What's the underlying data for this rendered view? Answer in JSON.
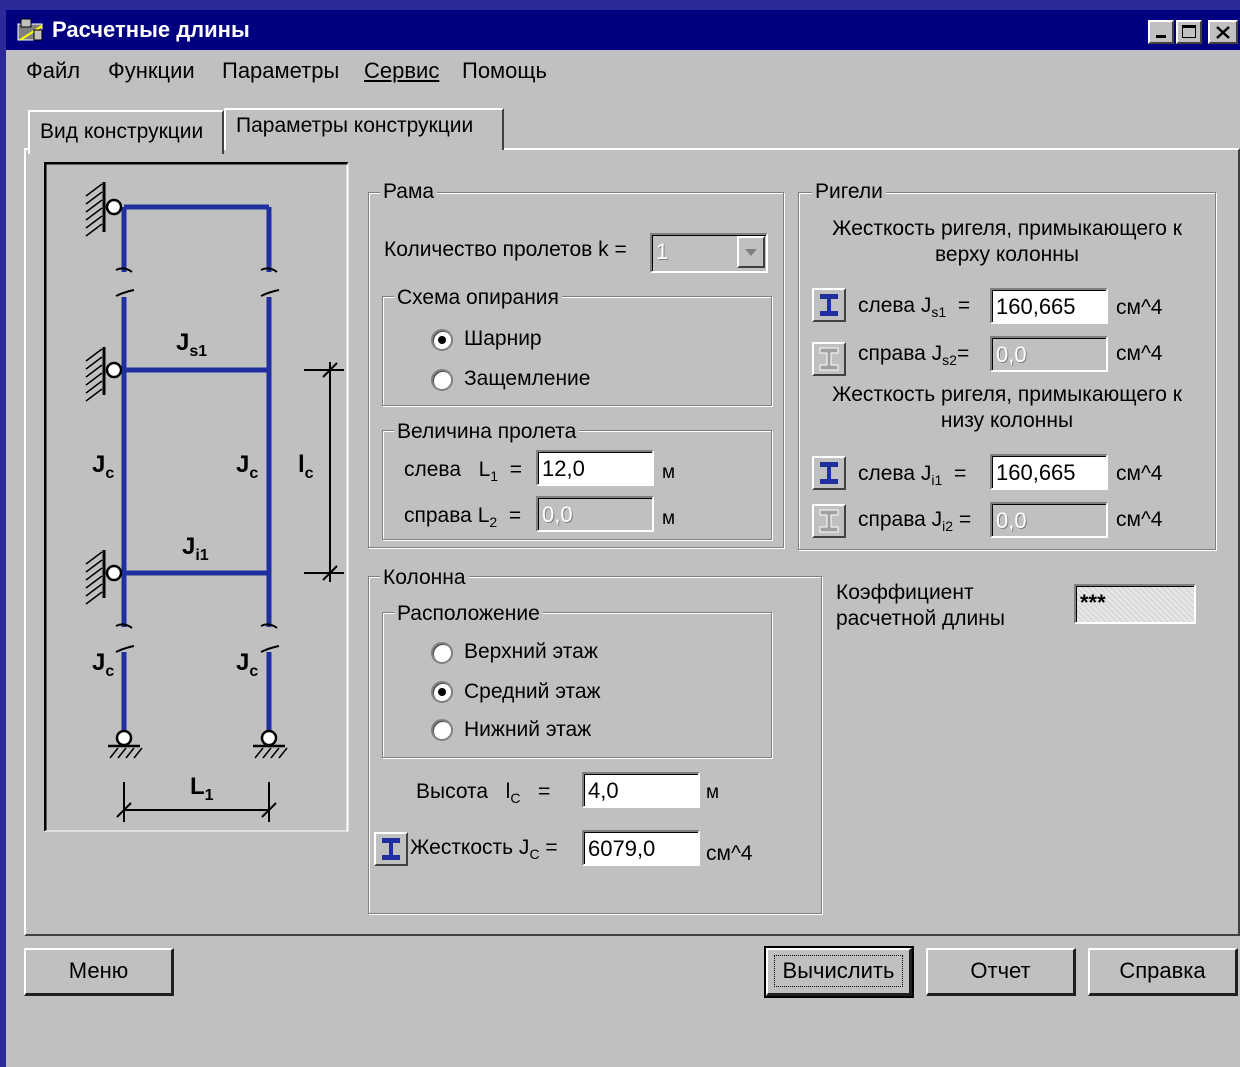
{
  "window": {
    "title": "Расчетные длины"
  },
  "menu": [
    "Файл",
    "Функции",
    "Параметры",
    "Сервис",
    "Помощь"
  ],
  "tabs": [
    "Вид конструкции",
    "Параметры конструкции"
  ],
  "diagram": {
    "js1": "J",
    "js1_sub": "s1",
    "ji1": "J",
    "ji1_sub": "i1",
    "jc": "J",
    "jc_sub": "c",
    "lc": "l",
    "lc_sub": "c",
    "l1": "L",
    "l1_sub": "1"
  },
  "rama": {
    "legend": "Рама",
    "spans_label": "Количество пролетов k =",
    "spans_value": "1",
    "support": {
      "legend": "Схема опирания",
      "options": [
        "Шарнир",
        "Защемление"
      ],
      "selected": 0
    },
    "span": {
      "legend": "Величина пролета",
      "left_label": "слева",
      "left_sym": "L",
      "left_sub": "1",
      "left_value": "12,0",
      "right_label": "справа",
      "right_sym": "L",
      "right_sub": "2",
      "right_value": "0,0",
      "eq": "=",
      "unit": "м"
    }
  },
  "rigeli": {
    "legend": "Ригели",
    "top_heading": "Жесткость ригеля, примыкающего к верху колонны",
    "bottom_heading": "Жесткость ригеля, примыкающего к низу колонны",
    "rows": [
      {
        "label": "слева J",
        "sub": "s1",
        "value": "160,665",
        "unit": "см^4",
        "disabled": false
      },
      {
        "label": "справа J",
        "sub": "s2",
        "value": "0,0",
        "unit": "см^4",
        "disabled": true
      },
      {
        "label": "слева J",
        "sub": "i1",
        "value": "160,665",
        "unit": "см^4",
        "disabled": false
      },
      {
        "label": "справа J",
        "sub": "i2",
        "value": "0,0",
        "unit": "см^4",
        "disabled": true
      }
    ],
    "eq": "="
  },
  "kolonna": {
    "legend": "Колонна",
    "position": {
      "legend": "Расположение",
      "options": [
        "Верхний этаж",
        "Средний этаж",
        "Нижний этаж"
      ],
      "selected": 1
    },
    "height": {
      "label": "Высота",
      "sym": "l",
      "sub": "C",
      "eq": "=",
      "value": "4,0",
      "unit": "м"
    },
    "stiffness": {
      "label": "Жесткость J",
      "sub": "C",
      "eq": "=",
      "value": "6079,0",
      "unit": "см^4"
    }
  },
  "coef": {
    "label_line1": "Коэффициент",
    "label_line2": "расчетной длины",
    "value": "***"
  },
  "buttons": {
    "menu": "Меню",
    "calc": "Вычислить",
    "report": "Отчет",
    "help": "Справка"
  },
  "colors": {
    "titlebar": "#000080",
    "frame": "#1f2fa0",
    "face": "#c0c0c0"
  }
}
